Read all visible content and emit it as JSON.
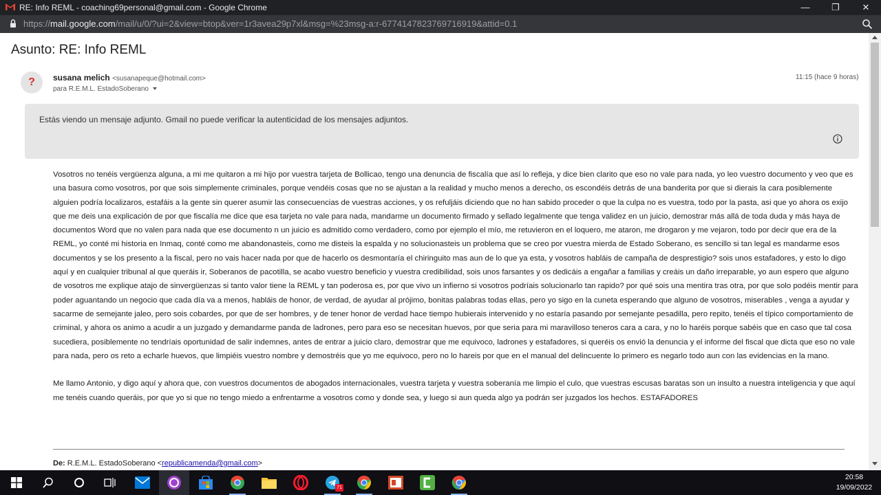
{
  "window": {
    "title": "RE: Info REML - coaching69personal@gmail.com - Google Chrome",
    "controls": {
      "minimize": "—",
      "maximize": "❐",
      "close": "✕"
    }
  },
  "address_bar": {
    "url_prefix": "https://",
    "url_domain": "mail.google.com",
    "url_path": "/mail/u/0/?ui=2&view=btop&ver=1r3avea29p7xl&msg=%23msg-a:r-6774147823769716919&attid=0.1"
  },
  "email": {
    "subject": "Asunto: RE: Info REML",
    "avatar_glyph": "?",
    "sender_name": "susana melich",
    "sender_email": "<susanapeque@hotmail.com>",
    "recipient": "para R.E.M.L. EstadoSoberano",
    "time": "11:15 (hace 9 horas)",
    "notice": "Estás viendo un mensaje adjunto. Gmail no puede verificar la autenticidad de los mensajes adjuntos.",
    "body_paragraph_1": "Vosotros no tenéis vergüenza alguna, a mi me quitaron a mi hijo por vuestra tarjeta de Bollicao, tengo una denuncia de fiscalía que así lo refleja, y dice bien clarito que eso no vale para nada, yo leo vuestro documento y veo que es una basura como vosotros, por que sois simplemente criminales, porque vendéis cosas que no se ajustan a la realidad y mucho menos a derecho, os escondéis detrás de una banderita por que si dierais la cara posiblemente alguien podría localizaros, estafáis a la gente sin querer asumir las consecuencias de vuestras acciones, y os refuljáis diciendo que no han sabido proceder o que la culpa no es vuestra, todo por la pasta, asi que yo ahora os exijo que me deis una explicación de por que fiscalía me dice que esa tarjeta no vale para nada, mandarme un documento firmado y sellado legalmente que tenga validez en un juicio, demostrar más allá de toda duda y más haya de documentos Word que no valen para nada que ese documento n un juicio es admitido como verdadero, como por ejemplo el mío, me retuvieron en el loquero, me ataron, me drogaron y me vejaron, todo por decir que era de la REML, yo conté mi historia en Inmaq, conté como me abandonasteis, como me disteis la espalda y no solucionasteis un problema que se creo por vuestra mierda de Estado Soberano, es sencillo si tan legal es mandarme esos documentos y se los presento a la fiscal, pero no vais hacer nada por que de hacerlo os desmontaría el chiringuito mas aun de lo que ya esta, y vosotros habláis de campaña de desprestigio? sois unos estafadores, y esto lo digo aquí y en cualquier tribunal al que queráis ir, Soberanos de pacotilla, se acabo vuestro beneficio y vuestra credibilidad, sois unos farsantes y os dedicáis a engañar a familias y creáis un daño irreparable, yo aun espero que alguno de vosotros me explique atajo de sinvergüenzas si tanto valor tiene la REML y tan poderosa es, por que vivo un infierno si vosotros podríais solucionarlo tan rapido? por qué sois una mentira tras otra,  por que solo podéis mentir para poder aguantando un negocio que cada día va a menos, habláis de honor, de verdad, de ayudar al prójimo, bonitas palabras todas ellas, pero yo sigo en la cuneta esperando que alguno de vosotros, miserables , venga a ayudar y sacarme de semejante jaleo, pero sois cobardes, por que de ser hombres, y de tener honor de verdad hace tiempo hubierais intervenido y no estaría pasando por semejante pesadilla, pero repito, tenéis el típico comportamiento de criminal, y ahora os animo a acudir a un juzgado y demandarme panda de ladrones, pero para eso se necesitan huevos, por que seria para mi maravilloso teneros cara a cara, y no lo haréis porque sabéis que en caso que tal cosa sucediera, posiblemente no tendríais oportunidad de salir indemnes, antes de entrar a juicio claro, demostrar que me equivoco, ladrones y estafadores, si queréis os envió la denuncia y el informe del fiscal que dicta que eso no vale para nada, pero os reto a echarle huevos, que limpiéis vuestro nombre y demostréis que yo me equivoco, pero no lo hareis por que en el manual del delincuente lo primero es negarlo todo aun con las evidencias en la mano.",
    "body_paragraph_2": "Me llamo Antonio, y digo aquí y ahora que, con vuestros documentos de abogados internacionales, vuestra tarjeta y vuestra soberanía me limpio el culo, que vuestras escusas baratas son un insulto a nuestra inteligencia y que aquí me tenéis cuando queráis, por que yo si que no tengo miedo a enfrentarme a vosotros como y donde sea, y luego si aun queda algo ya podrán ser juzgados los hechos. ESTAFADORES",
    "quoted_from_label": "De:",
    "quoted_from_name": " R.E.M.L. EstadoSoberano <",
    "quoted_from_email": "republicamenda@gmail.com",
    "quoted_from_close": ">"
  },
  "taskbar": {
    "time": "20:58",
    "date": "19/09/2022",
    "telegram_badge": "71",
    "items": [
      "start-icon",
      "search-icon",
      "cortana-icon",
      "task-view-icon",
      "mail-icon",
      "app-circle-icon",
      "store-icon",
      "chrome-icon",
      "file-explorer-icon",
      "opera-icon",
      "telegram-icon",
      "chrome-alt-icon",
      "powerpoint-icon",
      "camtasia-icon",
      "chrome-profile-icon"
    ]
  },
  "colors": {
    "chrome_dark": "#202124",
    "notice_bg": "#e6e6e6",
    "link": "#1a0dab",
    "taskbar": "#0f0f14"
  }
}
